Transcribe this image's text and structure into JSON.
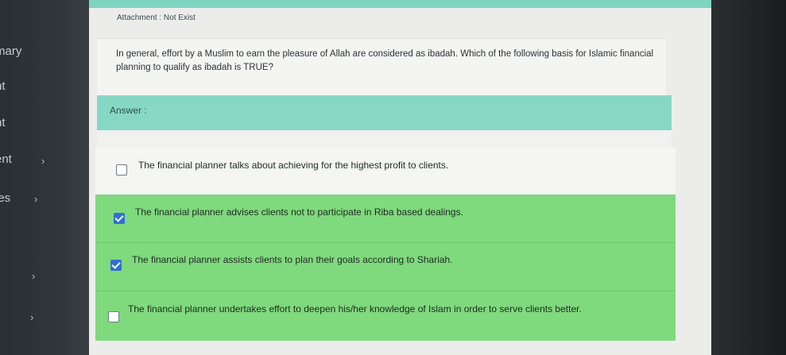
{
  "attachment": "Attachment : Not Exist",
  "question": "In general, effort by a Muslim to earn the pleasure of Allah are considered as ibadah. Which of the following basis for Islamic financial planning to qualify as ibadah is TRUE?",
  "answer_label": "Answer :",
  "sidebar": {
    "items": [
      {
        "label": "mary"
      },
      {
        "label": "nt"
      },
      {
        "label": "nt"
      },
      {
        "label": "ent"
      },
      {
        "label": "ies"
      }
    ],
    "chevron": "›"
  },
  "options": [
    {
      "text": "The financial planner talks about achieving for the highest profit to clients.",
      "checked": false,
      "highlight": false
    },
    {
      "text": "The financial planner advises clients not to participate in Riba based dealings.",
      "checked": true,
      "highlight": true
    },
    {
      "text": "The financial planner assists clients to plan their goals according to Shariah.",
      "checked": true,
      "highlight": true
    },
    {
      "text": "The financial planner undertakes effort to deepen his/her knowledge of Islam in order to serve clients better.",
      "checked": false,
      "highlight": true
    }
  ],
  "colors": {
    "accent": "#86d8c4",
    "correct_highlight": "#7fd97d",
    "checkbox_checked": "#2f6fd1"
  }
}
